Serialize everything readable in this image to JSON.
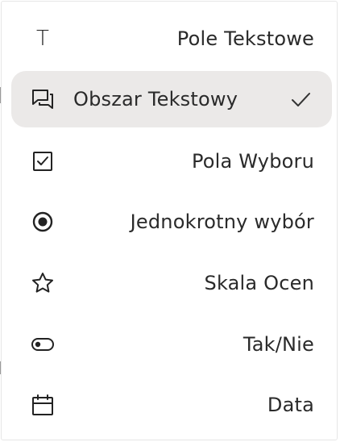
{
  "menu": {
    "items": [
      {
        "label": "Pole Tekstowe",
        "icon": "text-icon",
        "selected": false
      },
      {
        "label": "Obszar Tekstowy",
        "icon": "textarea-icon",
        "selected": true
      },
      {
        "label": "Pola Wyboru",
        "icon": "checkbox-icon",
        "selected": false
      },
      {
        "label": "Jednokrotny wybór",
        "icon": "radio-icon",
        "selected": false
      },
      {
        "label": "Skala Ocen",
        "icon": "star-icon",
        "selected": false
      },
      {
        "label": "Tak/Nie",
        "icon": "toggle-icon",
        "selected": false
      },
      {
        "label": "Data",
        "icon": "calendar-icon",
        "selected": false
      }
    ]
  },
  "colors": {
    "selected_background": "#ebe9e8",
    "text": "#2a2a2a",
    "icon": "#222222",
    "border": "#e6e6e6"
  }
}
